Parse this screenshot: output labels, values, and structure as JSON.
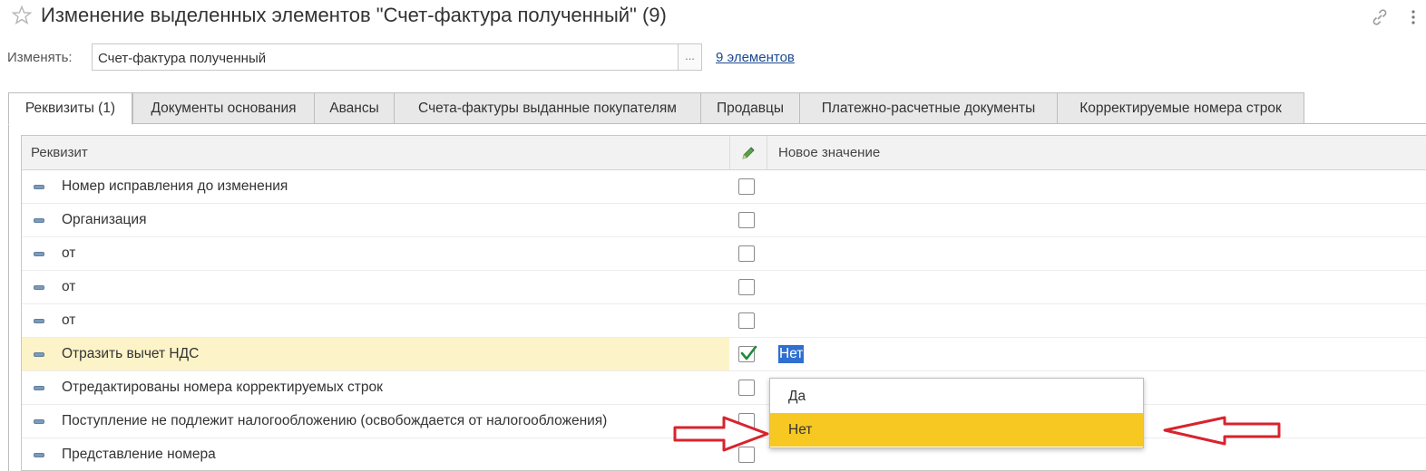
{
  "window": {
    "title": "Изменение выделенных элементов \"Счет-фактура полученный\" (9)"
  },
  "change_row": {
    "label": "Изменять:",
    "value": "Счет-фактура полученный",
    "select_button": "...",
    "elements_link": "9 элементов"
  },
  "tabs": [
    {
      "label": "Реквизиты (1)",
      "active": true
    },
    {
      "label": "Документы основания",
      "active": false
    },
    {
      "label": "Авансы",
      "active": false
    },
    {
      "label": "Счета-фактуры выданные покупателям",
      "active": false
    },
    {
      "label": "Продавцы",
      "active": false
    },
    {
      "label": "Платежно-расчетные документы",
      "active": false
    },
    {
      "label": "Корректируемые номера строк",
      "active": false
    }
  ],
  "table": {
    "headers": {
      "attribute": "Реквизит",
      "new_value": "Новое значение"
    },
    "rows": [
      {
        "name": "Номер исправления до изменения",
        "checked": false,
        "value": ""
      },
      {
        "name": "Организация",
        "checked": false,
        "value": ""
      },
      {
        "name": "от",
        "checked": false,
        "value": ""
      },
      {
        "name": "от",
        "checked": false,
        "value": ""
      },
      {
        "name": "от",
        "checked": false,
        "value": ""
      },
      {
        "name": "Отразить вычет НДС",
        "checked": true,
        "value": "Нет"
      },
      {
        "name": "Отредактированы номера корректируемых строк",
        "checked": false,
        "value": ""
      },
      {
        "name": "Поступление не подлежит налогообложению (освобождается от налогообложения)",
        "checked": false,
        "value": ""
      },
      {
        "name": "Представление номера",
        "checked": false,
        "value": ""
      }
    ]
  },
  "dropdown": {
    "options": [
      {
        "label": "Да",
        "highlighted": false
      },
      {
        "label": "Нет",
        "highlighted": true
      }
    ]
  },
  "colors": {
    "highlight": "#f7c821",
    "selected_row": "#fdf3c8",
    "arrow": "#d9232d",
    "link": "#1c4a90"
  },
  "icons": {
    "favorite": "star-icon",
    "link": "link-icon",
    "more": "more-vertical-icon",
    "edit_column": "pencil-icon",
    "row_marker": "dash-icon"
  }
}
